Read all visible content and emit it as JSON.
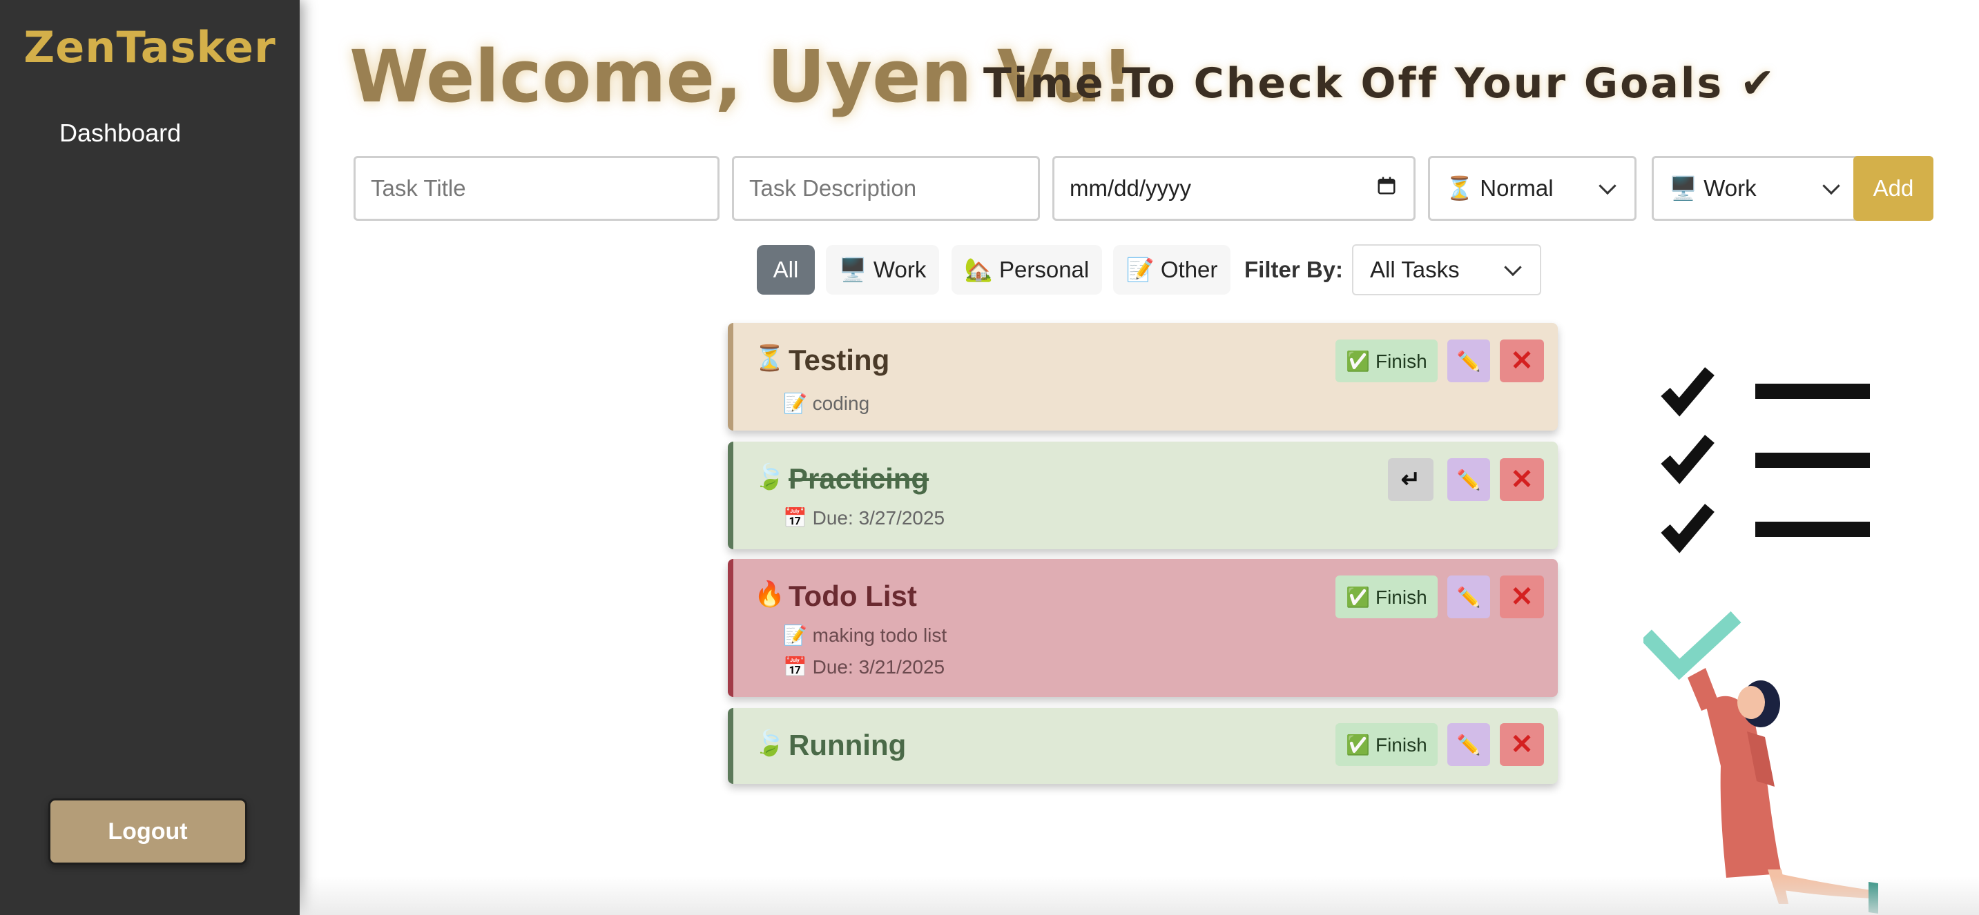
{
  "app": {
    "brand": "ZenTasker"
  },
  "sidebar": {
    "items": [
      {
        "label": "Dashboard"
      }
    ],
    "logout_label": "Logout"
  },
  "header": {
    "welcome": "Welcome, Uyen Vu!",
    "tagline": "Time To Check Off Your Goals ✔"
  },
  "form": {
    "title_placeholder": "Task Title",
    "description_placeholder": "Task Description",
    "date_placeholder": "mm/dd/yyyy",
    "priority_value": "⏳ Normal",
    "category_value": "🖥️ Work",
    "add_label": "Add"
  },
  "filters": {
    "chips": [
      {
        "label": "All"
      },
      {
        "label": "🖥️ Work"
      },
      {
        "label": "🏡 Personal"
      },
      {
        "label": "📝 Other"
      }
    ],
    "active": "All",
    "filter_label": "Filter By:",
    "filter_value": "All Tasks"
  },
  "tasks": [
    {
      "emoji": "⏳",
      "title": "Testing",
      "description": "📝 coding",
      "due": "",
      "completed": false,
      "finish_label": "✅ Finish"
    },
    {
      "emoji": "🍃",
      "title": "Practicing",
      "description": "",
      "due": "📅 Due: 3/27/2025",
      "completed": true,
      "undo_label": "↵"
    },
    {
      "emoji": "🔥",
      "title": "Todo List",
      "description": "📝 making todo list",
      "due": "📅 Due: 3/21/2025",
      "completed": false,
      "finish_label": "✅ Finish"
    },
    {
      "emoji": "🍃",
      "title": "Running",
      "description": "",
      "due": "",
      "completed": false,
      "finish_label": "✅ Finish"
    }
  ],
  "icons": {
    "edit": "✏️",
    "delete": "✕",
    "calendar": "calendar-icon",
    "chevron": "chevron-down-icon"
  },
  "colors": {
    "brand": "#d4b04a",
    "sidebar": "#333333",
    "logout": "#b49d78",
    "welcome": "#9a8052"
  }
}
